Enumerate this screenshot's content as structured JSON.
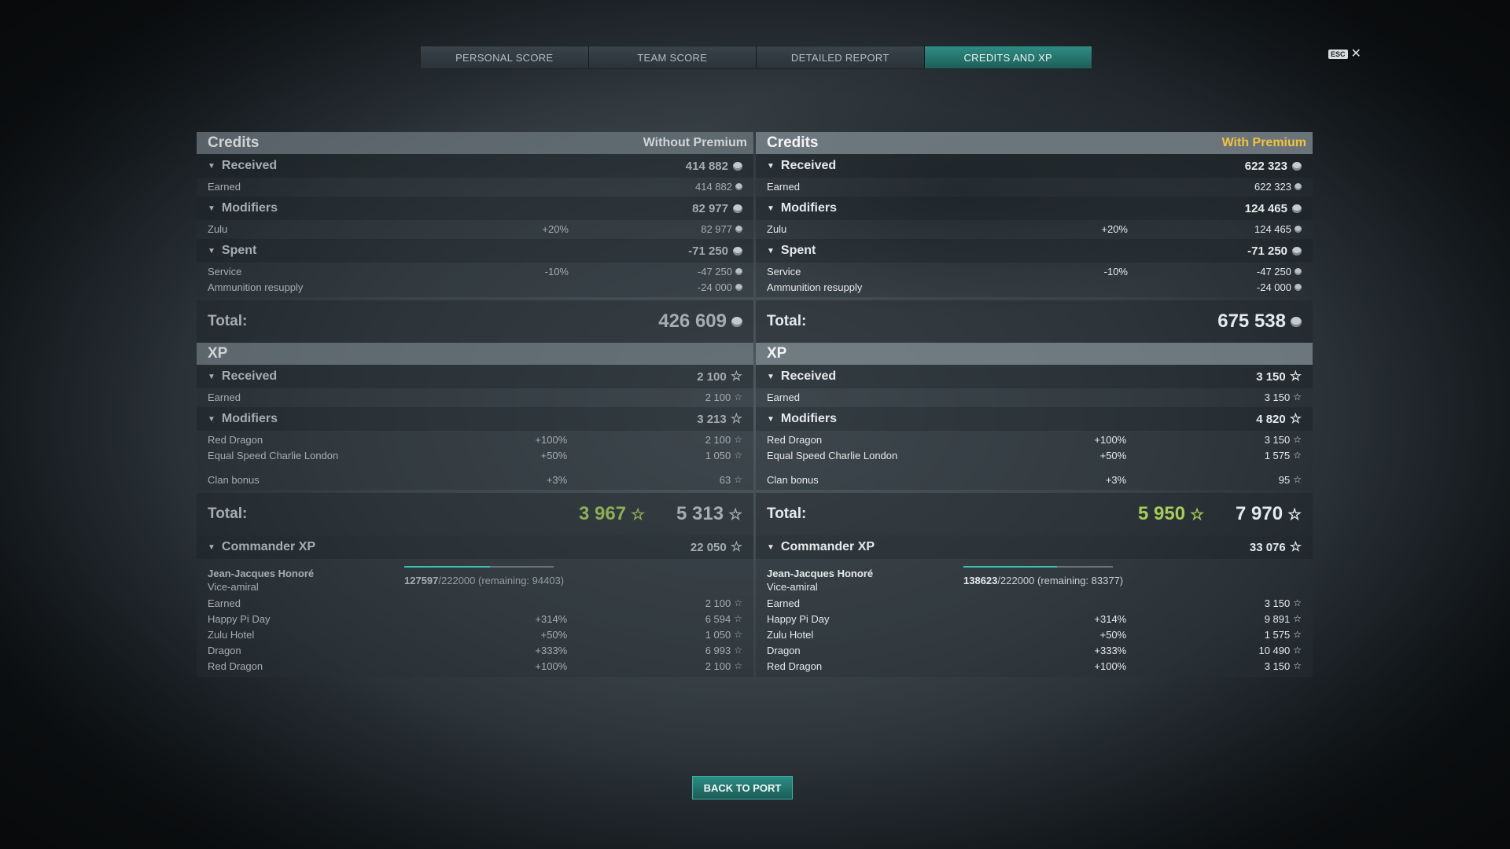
{
  "tabs": [
    {
      "label": "PERSONAL SCORE"
    },
    {
      "label": "TEAM SCORE"
    },
    {
      "label": "DETAILED REPORT"
    },
    {
      "label": "CREDITS AND XP"
    }
  ],
  "esc": {
    "key": "ESC",
    "close": "✕"
  },
  "back_button": "BACK TO PORT",
  "panels": {
    "left": {
      "mode": "Without Premium",
      "credits": {
        "title": "Credits",
        "received": {
          "label": "Received",
          "value": "414 882",
          "rows": [
            {
              "name": "Earned",
              "pct": "",
              "value": "414 882"
            }
          ]
        },
        "modifiers": {
          "label": "Modifiers",
          "value": "82 977",
          "rows": [
            {
              "name": "Zulu",
              "pct": "+20%",
              "value": "82 977"
            }
          ]
        },
        "spent": {
          "label": "Spent",
          "value": "-71 250",
          "rows": [
            {
              "name": "Service",
              "pct": "-10%",
              "value": "-47 250"
            },
            {
              "name": "Ammunition resupply",
              "pct": "",
              "value": "-24 000"
            }
          ]
        },
        "total_label": "Total:",
        "total": "426 609"
      },
      "xp": {
        "title": "XP",
        "received": {
          "label": "Received",
          "value": "2 100",
          "rows": [
            {
              "name": "Earned",
              "pct": "",
              "value": "2 100"
            }
          ]
        },
        "modifiers": {
          "label": "Modifiers",
          "value": "3 213",
          "rows": [
            {
              "name": "Red Dragon",
              "pct": "+100%",
              "value": "2 100"
            },
            {
              "name": "Equal Speed Charlie London",
              "pct": "+50%",
              "value": "1 050"
            },
            {
              "name": "Clan bonus",
              "pct": "+3%",
              "value": "63"
            }
          ]
        },
        "total_label": "Total:",
        "total_base": "3 967",
        "total": "5 313"
      },
      "commander": {
        "label": "Commander XP",
        "value": "22 050",
        "name": "Jean-Jacques Honoré",
        "rank": "Vice-amiral",
        "current": "127597",
        "max": "/222000",
        "remaining": "(remaining: 94403)",
        "progress": 0.575,
        "rows": [
          {
            "name": "Earned",
            "pct": "",
            "value": "2 100"
          },
          {
            "name": "Happy Pi Day",
            "pct": "+314%",
            "value": "6 594"
          },
          {
            "name": "Zulu Hotel",
            "pct": "+50%",
            "value": "1 050"
          },
          {
            "name": "Dragon",
            "pct": "+333%",
            "value": "6 993"
          },
          {
            "name": "Red Dragon",
            "pct": "+100%",
            "value": "2 100"
          }
        ]
      }
    },
    "right": {
      "mode": "With Premium",
      "credits": {
        "title": "Credits",
        "received": {
          "label": "Received",
          "value": "622 323",
          "rows": [
            {
              "name": "Earned",
              "pct": "",
              "value": "622 323"
            }
          ]
        },
        "modifiers": {
          "label": "Modifiers",
          "value": "124 465",
          "rows": [
            {
              "name": "Zulu",
              "pct": "+20%",
              "value": "124 465"
            }
          ]
        },
        "spent": {
          "label": "Spent",
          "value": "-71 250",
          "rows": [
            {
              "name": "Service",
              "pct": "-10%",
              "value": "-47 250"
            },
            {
              "name": "Ammunition resupply",
              "pct": "",
              "value": "-24 000"
            }
          ]
        },
        "total_label": "Total:",
        "total": "675 538"
      },
      "xp": {
        "title": "XP",
        "received": {
          "label": "Received",
          "value": "3 150",
          "rows": [
            {
              "name": "Earned",
              "pct": "",
              "value": "3 150"
            }
          ]
        },
        "modifiers": {
          "label": "Modifiers",
          "value": "4 820",
          "rows": [
            {
              "name": "Red Dragon",
              "pct": "+100%",
              "value": "3 150"
            },
            {
              "name": "Equal Speed Charlie London",
              "pct": "+50%",
              "value": "1 575"
            },
            {
              "name": "Clan bonus",
              "pct": "+3%",
              "value": "95"
            }
          ]
        },
        "total_label": "Total:",
        "total_base": "5 950",
        "total": "7 970"
      },
      "commander": {
        "label": "Commander XP",
        "value": "33 076",
        "name": "Jean-Jacques Honoré",
        "rank": "Vice-amiral",
        "current": "138623",
        "max": "/222000",
        "remaining": "(remaining: 83377)",
        "progress": 0.624,
        "rows": [
          {
            "name": "Earned",
            "pct": "",
            "value": "3 150"
          },
          {
            "name": "Happy Pi Day",
            "pct": "+314%",
            "value": "9 891"
          },
          {
            "name": "Zulu Hotel",
            "pct": "+50%",
            "value": "1 575"
          },
          {
            "name": "Dragon",
            "pct": "+333%",
            "value": "10 490"
          },
          {
            "name": "Red Dragon",
            "pct": "+100%",
            "value": "3 150"
          }
        ]
      }
    }
  }
}
